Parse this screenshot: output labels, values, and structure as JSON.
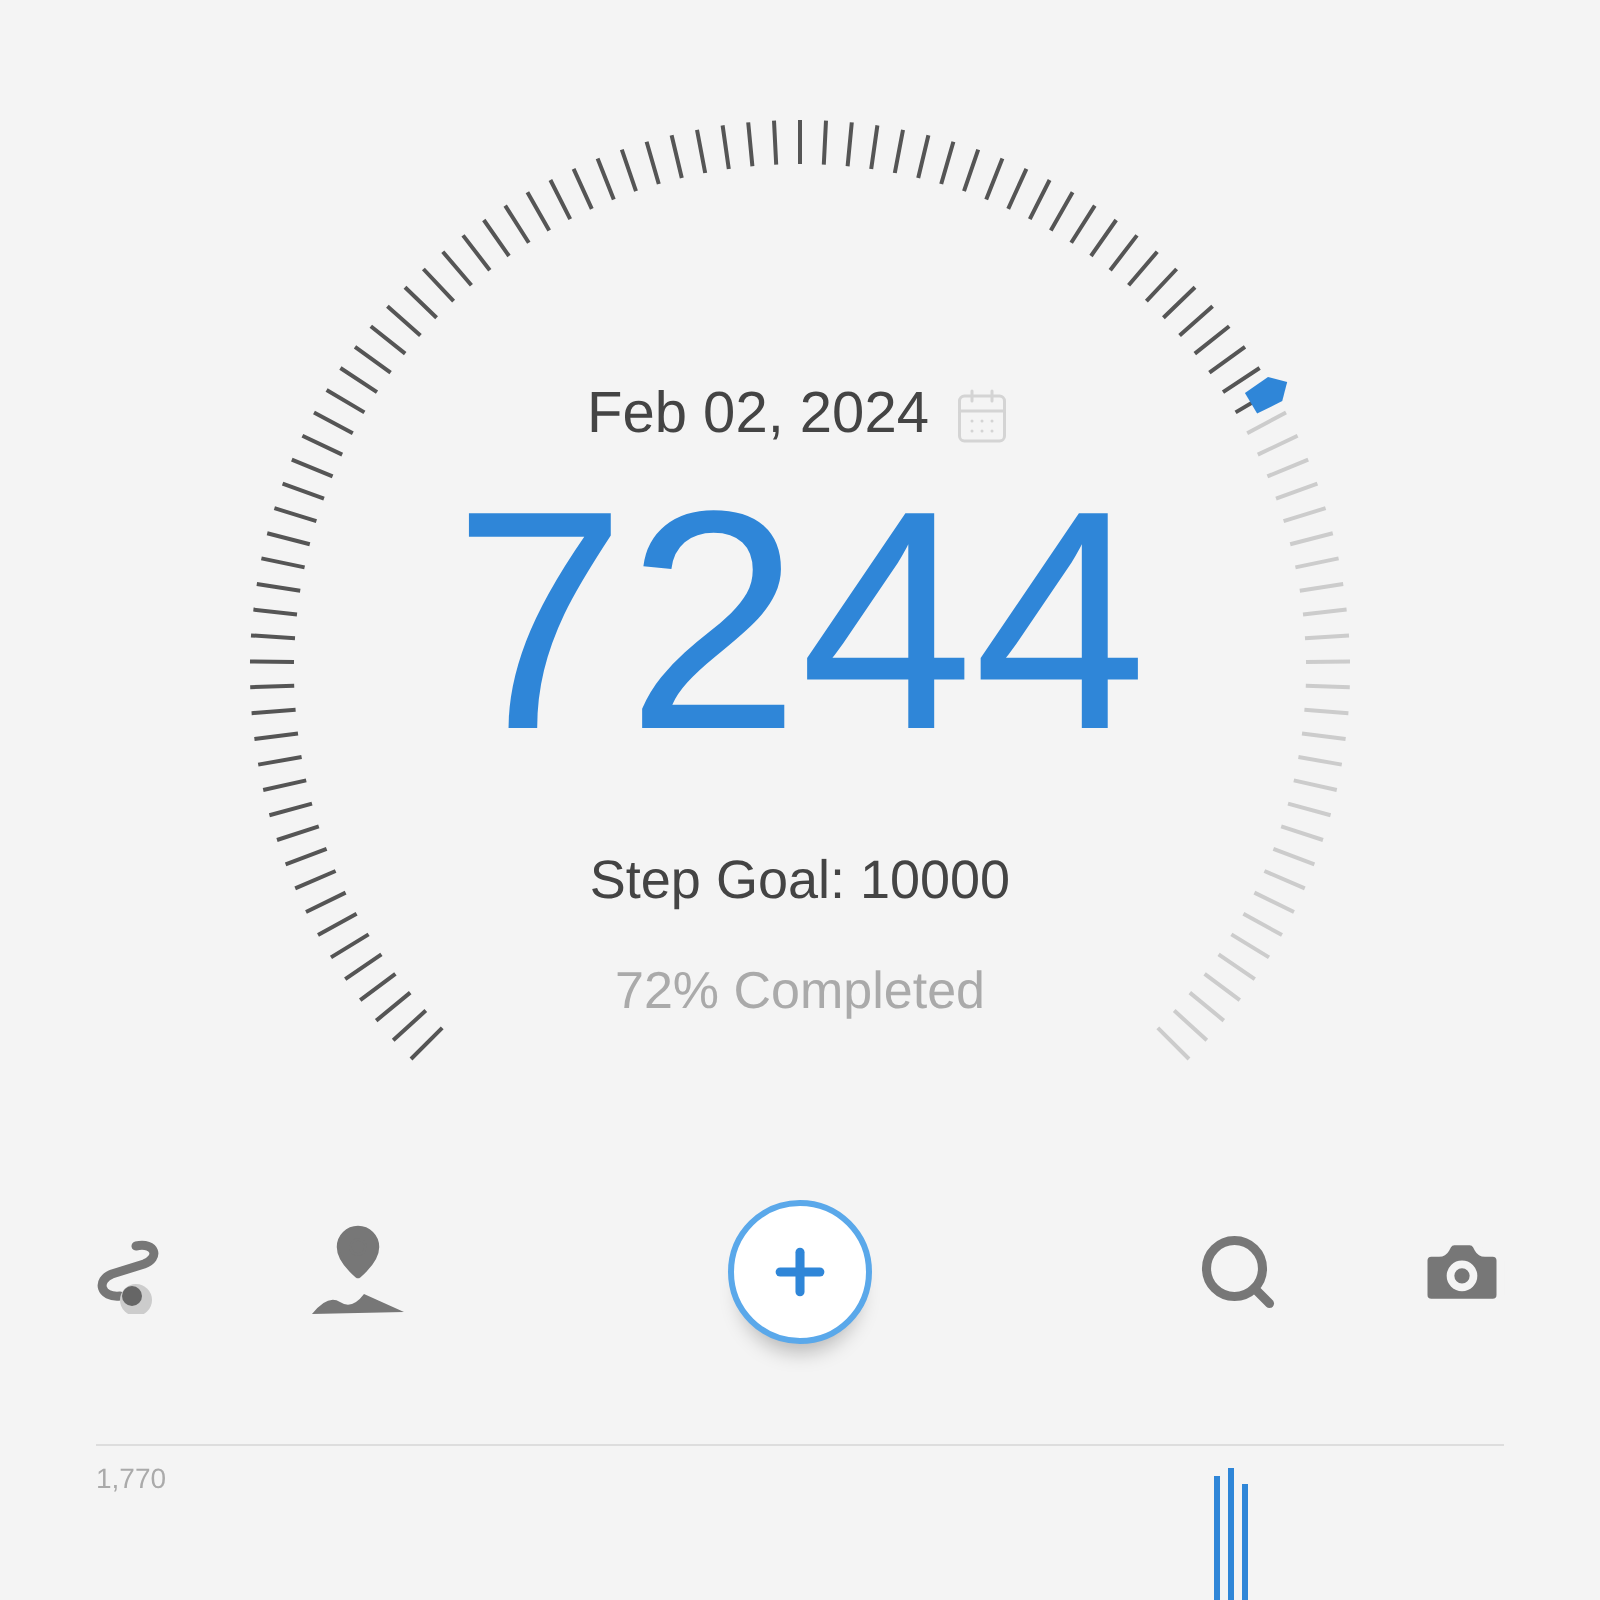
{
  "date": "Feb 02, 2024",
  "steps": "7244",
  "goal": "Step Goal: 10000",
  "completed": "72% Completed",
  "chart": {
    "max_label": "1,770"
  }
}
